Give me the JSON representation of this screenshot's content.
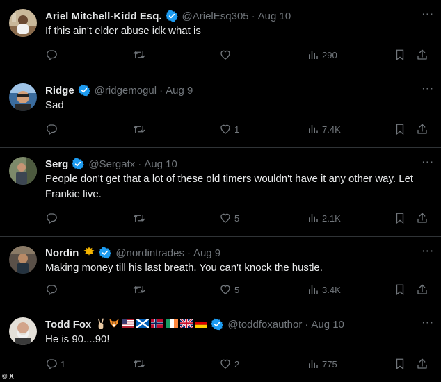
{
  "colors": {
    "background": "#000000",
    "text": "#e7e9ea",
    "muted": "#71767b",
    "verified": "#1d9bf0",
    "divider": "#2f3336"
  },
  "tweets": [
    {
      "name": "Ariel Mitchell-Kidd Esq.",
      "handle": "@ArielEsq305",
      "date": "Aug 10",
      "text": "If this ain't elder abuse idk what is",
      "replies": "",
      "retweets": "",
      "likes": "",
      "views": "290"
    },
    {
      "name": "Ridge",
      "handle": "@ridgemogul",
      "date": "Aug 9",
      "text": "Sad",
      "replies": "",
      "retweets": "",
      "likes": "1",
      "views": "7.4K"
    },
    {
      "name": "Serg",
      "handle": "@Sergatx",
      "date": "Aug 10",
      "text": "People don't get that a lot of these old timers wouldn't have it any other way. Let Frankie live.",
      "replies": "",
      "retweets": "",
      "likes": "5",
      "views": "2.1K"
    },
    {
      "name": "Nordin",
      "handle": "@nordintrades",
      "date": "Aug 9",
      "text": "Making money till his last breath. You can't knock the hustle.",
      "replies": "",
      "retweets": "",
      "likes": "5",
      "views": "3.4K"
    },
    {
      "name": "Todd Fox",
      "handle": "@toddfoxauthor",
      "date": "Aug 10",
      "text": "He is 90....90!",
      "replies": "1",
      "retweets": "",
      "likes": "2",
      "views": "775"
    }
  ],
  "separator": "·",
  "more_label": "···",
  "watermark": "© X",
  "icons": {
    "verified": "verified-badge-icon",
    "reply": "reply-icon",
    "retweet": "retweet-icon",
    "like": "heart-icon",
    "views": "views-chart-icon",
    "bookmark": "bookmark-icon",
    "share": "share-icon",
    "more": "more-options-icon"
  }
}
